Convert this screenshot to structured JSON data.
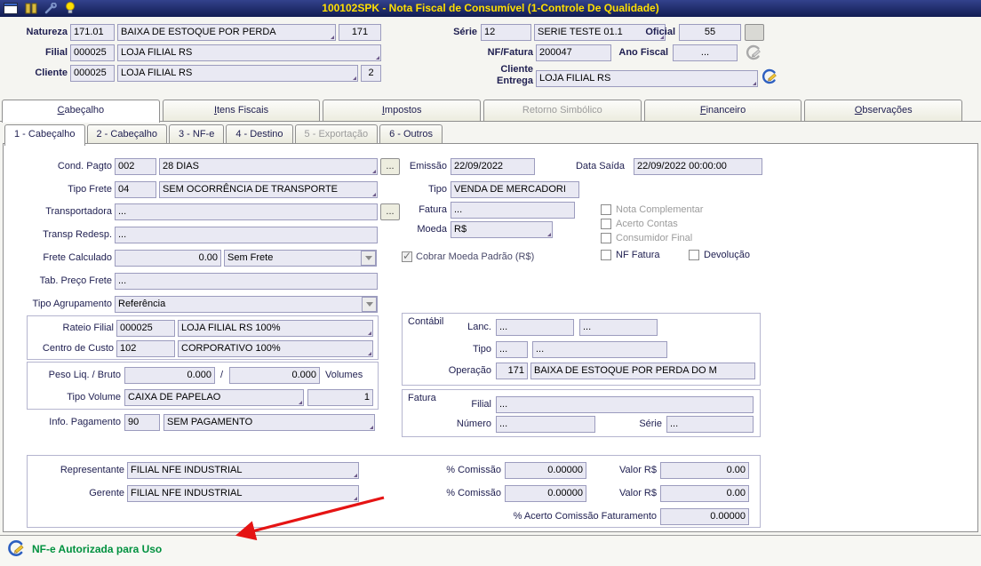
{
  "colors": {
    "titlebar_bg": "#1c2a66",
    "title_text": "#ffdf00",
    "field_bg": "#e9e9f3",
    "status_text": "#00913f",
    "arrow": "#e51414"
  },
  "titlebar": {
    "title": "100102SPK - Nota Fiscal de Consumível (1-Controle De Qualidade)"
  },
  "header": {
    "natureza_label": "Natureza",
    "natureza_code": "171.01",
    "natureza_desc": "BAIXA DE ESTOQUE POR PERDA",
    "natureza_num": "171",
    "serie_label": "Série",
    "serie_code": "12",
    "serie_desc": "SERIE TESTE 01.1",
    "oficial_label": "Oficial",
    "oficial_value": "55",
    "filial_label": "Filial",
    "filial_code": "000025",
    "filial_desc": "LOJA FILIAL RS",
    "nf_label": "NF/Fatura",
    "nf_value": "200047",
    "ano_label": "Ano Fiscal",
    "ano_value": "...",
    "cliente_label": "Cliente",
    "cliente_code": "000025",
    "cliente_desc": "LOJA FILIAL RS",
    "cliente_num": "2",
    "entrega_label": "Cliente Entrega",
    "entrega_value": "LOJA FILIAL RS"
  },
  "tabs": [
    {
      "label": "Cabeçalho",
      "active": true
    },
    {
      "label": "Itens Fiscais"
    },
    {
      "label": "Impostos"
    },
    {
      "label": "Retorno Simbólico",
      "disabled": true
    },
    {
      "label": "Financeiro"
    },
    {
      "label": "Observações"
    }
  ],
  "subtabs": [
    {
      "label": "1 - Cabeçalho",
      "active": true
    },
    {
      "label": "2 - Cabeçalho"
    },
    {
      "label": "3 - NF-e"
    },
    {
      "label": "4 - Destino"
    },
    {
      "label": "5 - Exportação",
      "disabled": true
    },
    {
      "label": "6 - Outros"
    }
  ],
  "form": {
    "cond_pagto": {
      "label": "Cond. Pagto",
      "code": "002",
      "desc": "28 DIAS",
      "lookup": "..."
    },
    "emissao": {
      "label": "Emissão",
      "value": "22/09/2022"
    },
    "data_saida": {
      "label": "Data Saída",
      "value": "22/09/2022 00:00:00"
    },
    "tipo_frete": {
      "label": "Tipo Frete",
      "code": "04",
      "desc": "SEM OCORRÊNCIA DE TRANSPORTE"
    },
    "tipo": {
      "label": "Tipo",
      "value": "VENDA DE MERCADORI"
    },
    "transportadora": {
      "label": "Transportadora",
      "value": "...",
      "lookup": "..."
    },
    "fatura": {
      "label": "Fatura",
      "value": "..."
    },
    "moeda": {
      "label": "Moeda",
      "value": "R$"
    },
    "transp_redesp": {
      "label": "Transp Redesp.",
      "value": "..."
    },
    "frete_calculado": {
      "label": "Frete Calculado",
      "value": "0.00",
      "option": "Sem Frete"
    },
    "tab_preco_frete": {
      "label": "Tab. Preço Frete",
      "value": "..."
    },
    "tipo_agrupamento": {
      "label": "Tipo Agrupamento",
      "option": "Referência"
    },
    "checks": {
      "cobrar_moeda": "Cobrar Moeda Padrão (R$)",
      "nota_complementar": "Nota Complementar",
      "acerto_contas": "Acerto Contas",
      "consumidor_final": "Consumidor Final",
      "nf_fatura": "NF Fatura",
      "devolucao": "Devolução"
    },
    "rateio_filial": {
      "label": "Rateio Filial",
      "code": "000025",
      "desc": "LOJA FILIAL RS 100%"
    },
    "centro_custo": {
      "label": "Centro de Custo",
      "code": "102",
      "desc": "CORPORATIVO 100%"
    },
    "contabil": {
      "title": "Contábil",
      "lanc_label": "Lanc.",
      "lanc_1": "...",
      "lanc_2": "...",
      "tipo_label": "Tipo",
      "tipo_1": "...",
      "tipo_2": "...",
      "operacao_label": "Operação",
      "operacao_code": "171",
      "operacao_desc": "BAIXA DE ESTOQUE POR PERDA DO M"
    },
    "peso": {
      "label": "Peso Liq. / Bruto",
      "liq": "0.000",
      "sep": "/",
      "bruto": "0.000",
      "volumes_label": "Volumes"
    },
    "tipo_volume": {
      "label": "Tipo Volume",
      "value": "CAIXA DE PAPELAO",
      "qty": "1"
    },
    "fatura_box": {
      "title": "Fatura",
      "filial_label": "Filial",
      "filial_value": "...",
      "numero_label": "Número",
      "numero_value": "...",
      "serie_label": "Série",
      "serie_value": "..."
    },
    "info_pagamento": {
      "label": "Info. Pagamento",
      "code": "90",
      "desc": "SEM PAGAMENTO"
    },
    "comissao": {
      "representante_label": "Representante",
      "representante_value": "FILIAL NFE INDUSTRIAL",
      "gerente_label": "Gerente",
      "gerente_value": "FILIAL NFE INDUSTRIAL",
      "pct_label": "% Comissão",
      "rep_pct": "0.00000",
      "ger_pct": "0.00000",
      "valor_label": "Valor R$",
      "rep_valor": "0.00",
      "ger_valor": "0.00",
      "acerto_label": "% Acerto Comissão Faturamento",
      "acerto_value": "0.00000"
    }
  },
  "statusbar": {
    "message": "NF-e Autorizada para Uso"
  }
}
